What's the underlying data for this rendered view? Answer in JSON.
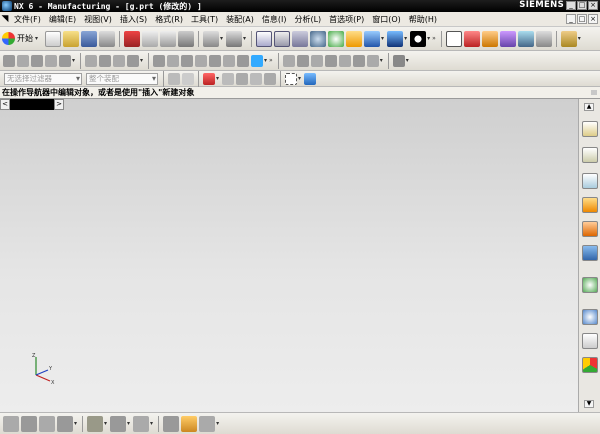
{
  "window": {
    "title": "NX 6 - Manufacturing - [g.prt (修改的) ]",
    "brand": "SIEMENS",
    "controls": [
      "_",
      "□",
      "×"
    ]
  },
  "menubar": {
    "items": [
      "文件(F)",
      "编辑(E)",
      "视图(V)",
      "插入(S)",
      "格式(R)",
      "工具(T)",
      "装配(A)",
      "信息(I)",
      "分析(L)",
      "首选项(P)",
      "窗口(O)",
      "帮助(H)"
    ],
    "mdi_controls": [
      "_",
      "□",
      "×"
    ]
  },
  "toolbar": {
    "start_label": "开始",
    "start_arrow": "▾",
    "dropdown_arrow": "▾",
    "overflow_mark": "»"
  },
  "selection_bar": {
    "filter_placeholder": "无选择过滤器",
    "scope_placeholder": "整个装配"
  },
  "cue_line": {
    "text": "在操作导航器中编辑对象，或者是使用\"插入\"新建对象"
  },
  "graphics": {
    "tab_prev": "<",
    "tab_next": ">",
    "triad_labels": [
      "Z",
      "Y",
      "X"
    ]
  },
  "resource_bar": {
    "icons": [
      "navigator-icon",
      "navigator-icon",
      "navigator-icon",
      "tool-library-icon",
      "machine-icon",
      "method-icon",
      "part-icon",
      "clock-icon",
      "list-icon",
      "palette-icon"
    ],
    "scroll_up": "▲",
    "scroll_down": "▼"
  },
  "colors": {
    "titlebar": "#000000",
    "menubar": "#ece9e2",
    "graphics_top": "#cfcfcf",
    "graphics_bottom": "#ededed"
  }
}
